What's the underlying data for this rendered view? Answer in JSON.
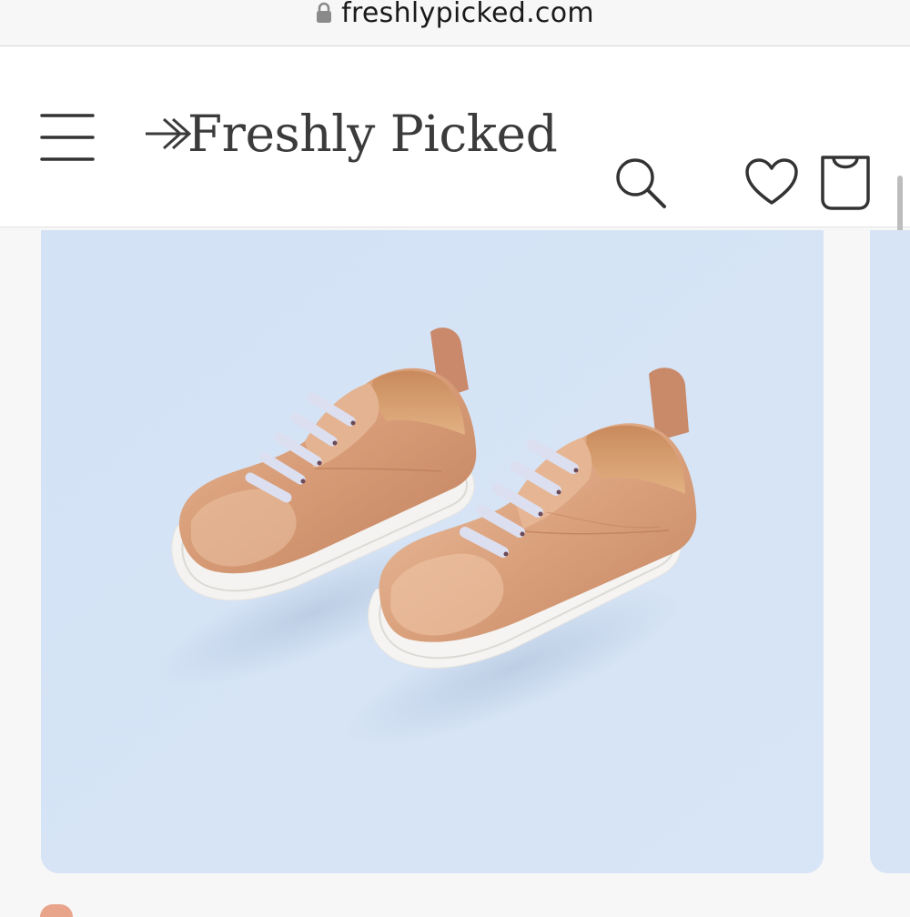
{
  "browser": {
    "url": "freshlypicked.com",
    "lock_icon": "lock-icon"
  },
  "header": {
    "brand": "Freshly Picked",
    "icons": {
      "menu": "hamburger-menu-icon",
      "search": "search-icon",
      "wishlist": "heart-icon",
      "cart": "shopping-bag-icon"
    }
  },
  "product": {
    "image_description_icon": "rose-gold-sneakers-image"
  },
  "colors": {
    "card_background": "#d6e4f5",
    "accent": "#e9a58c",
    "text": "#3b3b3b"
  }
}
